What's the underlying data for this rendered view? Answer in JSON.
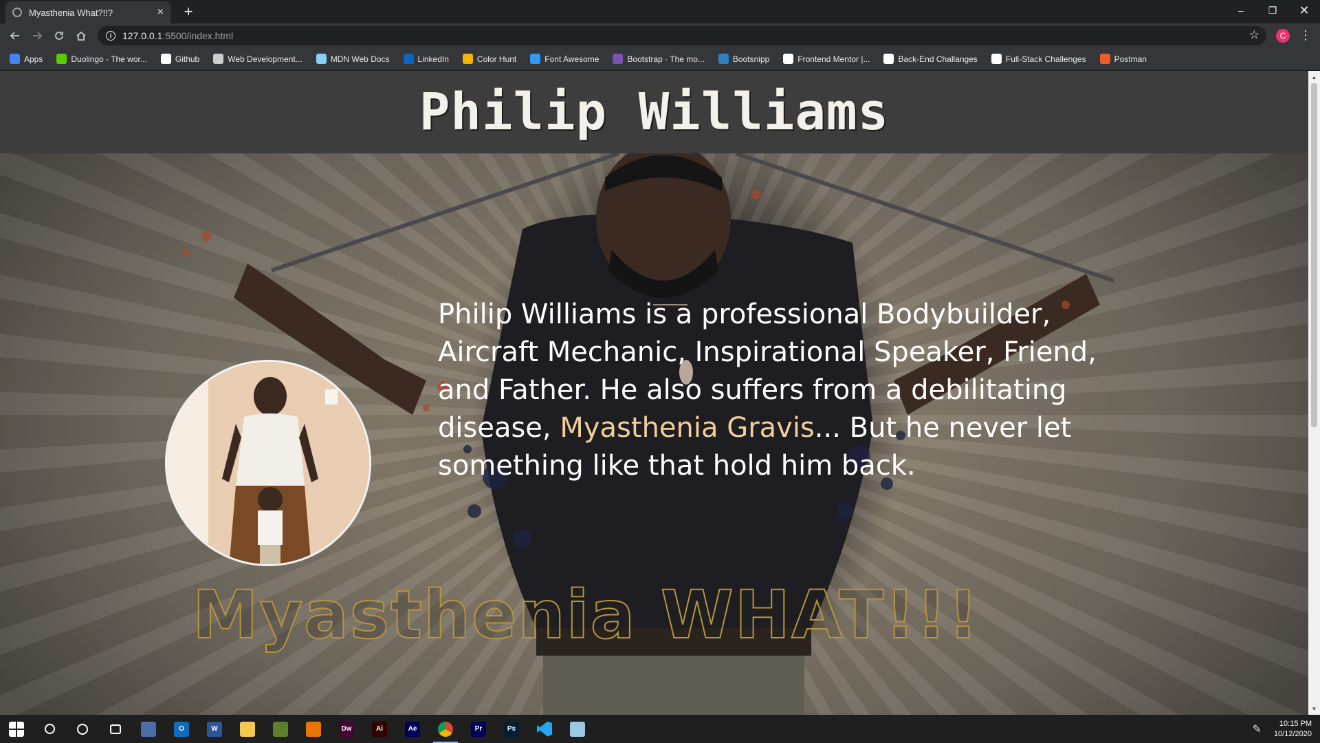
{
  "browser": {
    "tab_title": "Myasthenia What?!!?",
    "tab_close": "×",
    "new_tab": "+",
    "url_host": "127.0.0.1",
    "url_path": ":5500/index.html",
    "profile_initial": "C",
    "window_controls": {
      "minimize": "–",
      "restore": "❐",
      "close": "✕"
    }
  },
  "bookmarks": [
    {
      "label": "Apps",
      "icon": "apps-grid-icon",
      "color": "#4285f4"
    },
    {
      "label": "Duolingo - The wor...",
      "icon": "duolingo-icon",
      "color": "#58cc02"
    },
    {
      "label": "Github",
      "icon": "github-icon",
      "color": "#ffffff"
    },
    {
      "label": "Web Development...",
      "icon": "web-dev-icon",
      "color": "#cccccc"
    },
    {
      "label": "MDN Web Docs",
      "icon": "mdn-icon",
      "color": "#83d0f2"
    },
    {
      "label": "LinkedIn",
      "icon": "linkedin-icon",
      "color": "#0a66c2"
    },
    {
      "label": "Color Hunt",
      "icon": "color-hunt-icon",
      "color": "#f5b400"
    },
    {
      "label": "Font Awesome",
      "icon": "font-awesome-icon",
      "color": "#339af0"
    },
    {
      "label": "Bootstrap · The mo...",
      "icon": "bootstrap-icon",
      "color": "#7952b3"
    },
    {
      "label": "Bootsnipp",
      "icon": "bootsnipp-icon",
      "color": "#2d82c5"
    },
    {
      "label": "Frontend Mentor |...",
      "icon": "frontend-mentor-icon",
      "color": "#ffffff"
    },
    {
      "label": "Back-End Challanges",
      "icon": "github-icon",
      "color": "#ffffff"
    },
    {
      "label": "Full-Stack Challenges",
      "icon": "github-icon",
      "color": "#ffffff"
    },
    {
      "label": "Postman",
      "icon": "postman-icon",
      "color": "#ef5b25"
    }
  ],
  "page": {
    "site_title": "Philip Williams",
    "bio_part1": "Philip Williams is a professional Bodybuilder, Aircraft Mechanic, Inspirational Speaker, Friend, and Father. He also suffers from a debilitating disease, ",
    "bio_highlight": "Myasthenia Gravis",
    "bio_part2": "... But he never let something like that hold him back.",
    "big_title": "Myasthenia WHAT!!!",
    "highlight_color": "#f0cf9a",
    "title_outline_color": "#b9943a"
  },
  "taskbar": {
    "apps": [
      {
        "name": "start-button",
        "label": "",
        "color": "transparent"
      },
      {
        "name": "search-icon",
        "label": "",
        "color": "transparent"
      },
      {
        "name": "cortana-icon",
        "label": "",
        "color": "transparent"
      },
      {
        "name": "task-view-icon",
        "label": "",
        "color": "transparent"
      },
      {
        "name": "calculator-icon",
        "label": "",
        "color": "#4a6ea9"
      },
      {
        "name": "outlook-icon",
        "label": "O",
        "color": "#0f6cbd"
      },
      {
        "name": "word-icon",
        "label": "W",
        "color": "#2b579a"
      },
      {
        "name": "file-explorer-icon",
        "label": "",
        "color": "#f2c94c"
      },
      {
        "name": "minecraft-icon",
        "label": "",
        "color": "#5b7e2f"
      },
      {
        "name": "blender-icon",
        "label": "",
        "color": "#ea7600"
      },
      {
        "name": "dreamweaver-icon",
        "label": "Dw",
        "color": "#470137"
      },
      {
        "name": "illustrator-icon",
        "label": "Ai",
        "color": "#330000"
      },
      {
        "name": "after-effects-icon",
        "label": "Ae",
        "color": "#00005b"
      },
      {
        "name": "chrome-icon",
        "label": "",
        "color": "#e0e0e0"
      },
      {
        "name": "premiere-icon",
        "label": "Pr",
        "color": "#00005b"
      },
      {
        "name": "photoshop-icon",
        "label": "Ps",
        "color": "#001e36"
      },
      {
        "name": "vscode-icon",
        "label": "",
        "color": "#23a9f2"
      },
      {
        "name": "notepad-icon",
        "label": "",
        "color": "#9ac9e3"
      }
    ],
    "time": "10:15 PM",
    "date": "10/12/2020"
  }
}
